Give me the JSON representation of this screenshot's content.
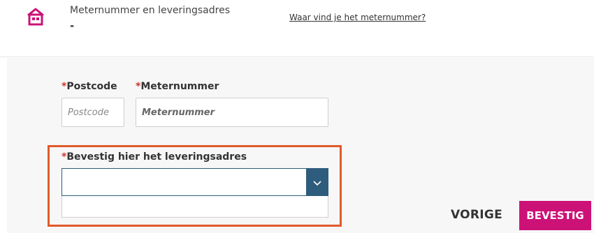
{
  "header": {
    "title": "Meternummer en leveringsadres",
    "value": "-",
    "help_link": "Waar vind je het meternummer?",
    "icon": "house-icon",
    "icon_color": "#cc1177"
  },
  "form": {
    "required_mark": "*",
    "postcode": {
      "label": "Postcode",
      "placeholder": "Postcode",
      "value": ""
    },
    "meternummer": {
      "label": "Meternummer",
      "placeholder": "Meternummer",
      "value": ""
    },
    "address": {
      "label": "Bevestig hier het leveringsadres",
      "selected": ""
    }
  },
  "buttons": {
    "prev": "VORIGE",
    "confirm": "BEVESTIG"
  },
  "colors": {
    "accent": "#cc1177",
    "highlight": "#e05a2b",
    "select": "#2e5c7d",
    "required": "#d2322d"
  }
}
